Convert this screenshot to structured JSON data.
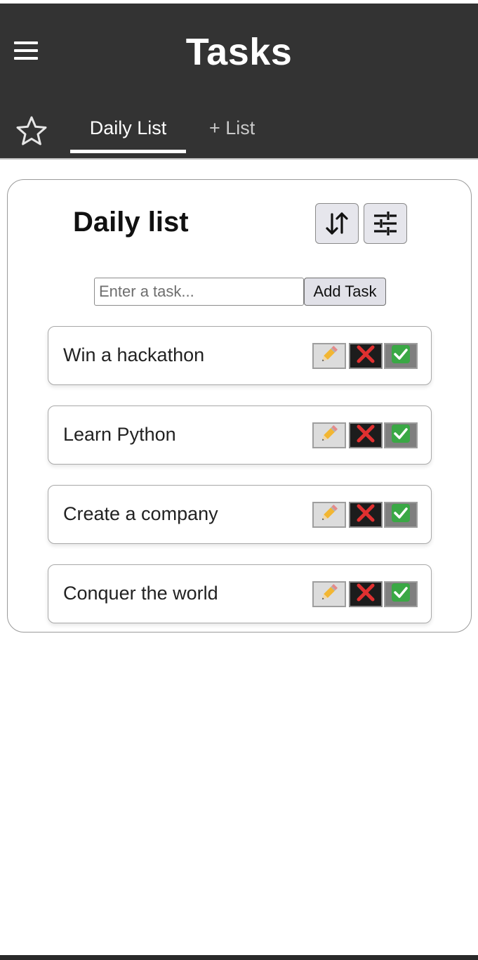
{
  "header": {
    "title": "Tasks",
    "tabs": [
      {
        "label": "Daily List",
        "active": true
      },
      {
        "label": "+ List",
        "active": false
      }
    ]
  },
  "list": {
    "title": "Daily list",
    "input_placeholder": "Enter a task...",
    "add_button_label": "Add Task",
    "tasks": [
      {
        "text": "Win a hackathon"
      },
      {
        "text": "Learn Python"
      },
      {
        "text": "Create a company"
      },
      {
        "text": "Conquer the world"
      }
    ]
  },
  "icons": {
    "menu": "menu-icon",
    "favorites": "star-icon",
    "sort": "sort-icon",
    "filter": "filter-icon",
    "edit": "pencil-icon",
    "delete": "cross-icon",
    "complete": "check-icon"
  },
  "colors": {
    "app_bar": "#333333",
    "delete_red": "#e03030",
    "check_green": "#3aa845"
  }
}
